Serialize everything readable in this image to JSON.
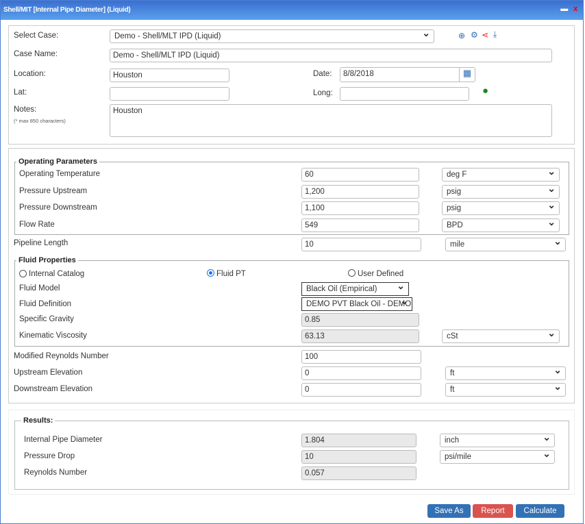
{
  "window": {
    "title": "Shell/MIT [Internal Pipe Diameter] (Liquid)",
    "minimize": "▬",
    "close": "x"
  },
  "case": {
    "select_case_label": "Select Case:",
    "select_case_value": "Demo - Shell/MLT IPD (Liquid)",
    "case_name_label": "Case Name:",
    "case_name_value": "Demo - Shell/MLT IPD (Liquid)",
    "location_label": "Location:",
    "location_value": "Houston",
    "date_label": "Date:",
    "date_value": "8/8/2018",
    "lat_label": "Lat:",
    "lat_value": "",
    "long_label": "Long:",
    "long_value": "",
    "notes_label": "Notes:",
    "notes_hint": "(* max 850 characters)",
    "notes_value": "Houston"
  },
  "operating": {
    "legend": "Operating Parameters",
    "rows": [
      {
        "label": "Operating Temperature",
        "value": "60",
        "unit": "deg F"
      },
      {
        "label": "Pressure Upstream",
        "value": "1,200",
        "unit": "psig"
      },
      {
        "label": "Pressure Downstream",
        "value": "1,100",
        "unit": "psig"
      },
      {
        "label": "Flow Rate",
        "value": "549",
        "unit": "BPD"
      }
    ]
  },
  "pipeline_length": {
    "label": "Pipeline Length",
    "value": "10",
    "unit": "mile"
  },
  "fluid": {
    "legend": "Fluid Properties",
    "radios": [
      {
        "label": "Internal Catalog",
        "checked": false
      },
      {
        "label": "Fluid PT",
        "checked": true
      },
      {
        "label": "User Defined",
        "checked": false
      }
    ],
    "model_label": "Fluid Model",
    "model_value": "Black Oil (Empirical)",
    "definition_label": "Fluid Definition",
    "definition_value": "DEMO PVT Black Oil - DEMO",
    "sg_label": "Specific Gravity",
    "sg_value": "0.85",
    "visc_label": "Kinematic Viscosity",
    "visc_value": "63.13",
    "visc_unit": "cSt"
  },
  "extra": {
    "reynolds_label": "Modified Reynolds Number",
    "reynolds_value": "100",
    "up_elev_label": "Upstream Elevation",
    "up_elev_value": "0",
    "up_elev_unit": "ft",
    "down_elev_label": "Downstream Elevation",
    "down_elev_value": "0",
    "down_elev_unit": "ft"
  },
  "results": {
    "legend": "Results:",
    "rows": [
      {
        "label": "Internal Pipe Diameter",
        "value": "1.804",
        "unit": "inch"
      },
      {
        "label": "Pressure Drop",
        "value": "10",
        "unit": "psi/mile"
      },
      {
        "label": "Reynolds Number",
        "value": "0.057"
      }
    ]
  },
  "buttons": {
    "save_as": "Save As",
    "report": "Report",
    "calculate": "Calculate"
  },
  "colors": {
    "primary": "#3371b5",
    "danger": "#d9534f",
    "title_bar": "#3a6fd0"
  }
}
